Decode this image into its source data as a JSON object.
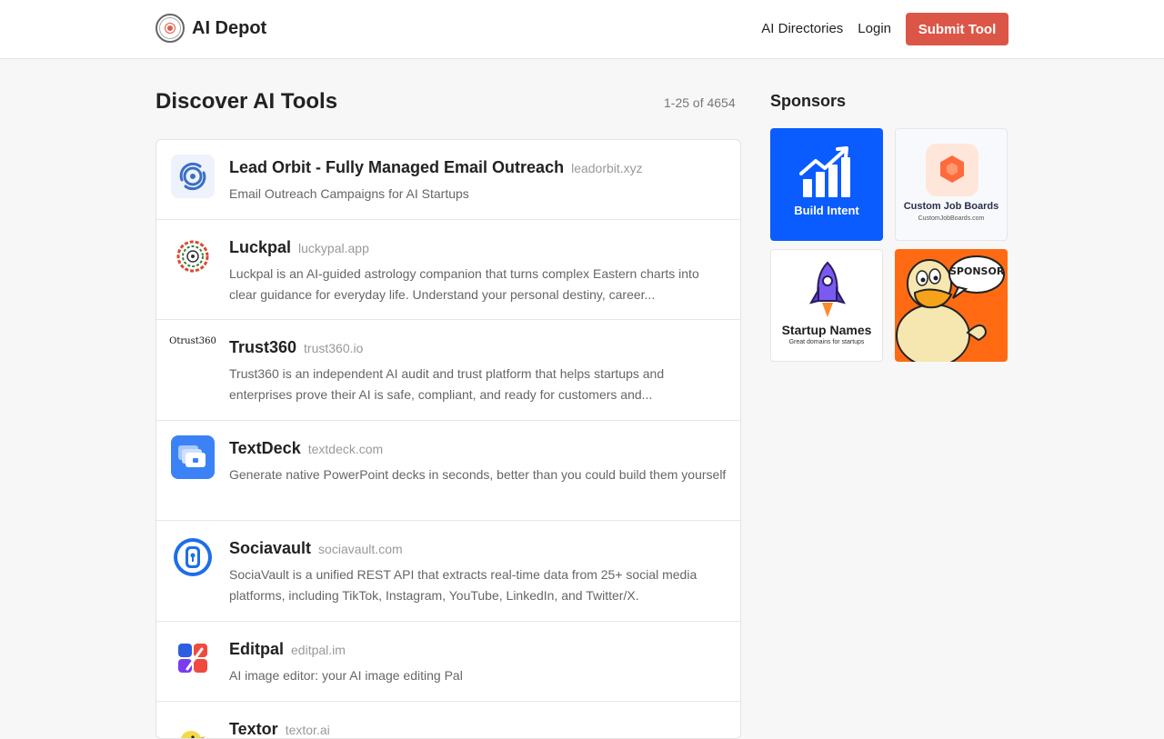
{
  "header": {
    "brand": "AI Depot",
    "nav": {
      "directories": "AI Directories",
      "login": "Login",
      "submit": "Submit Tool"
    }
  },
  "main": {
    "title": "Discover AI Tools",
    "count": "1-25 of 4654"
  },
  "tools": [
    {
      "name": "Lead Orbit - Fully Managed Email Outreach",
      "domain": "leadorbit.xyz",
      "description": "Email Outreach Campaigns for AI Startups"
    },
    {
      "name": "Luckpal",
      "domain": "luckypal.app",
      "description": "Luckpal is an AI-guided astrology companion that turns complex Eastern charts into clear guidance for everyday life. Understand your personal destiny, career..."
    },
    {
      "name": "Trust360",
      "domain": "trust360.io",
      "description": "Trust360 is an independent AI audit and trust platform that helps startups and enterprises prove their AI is safe, compliant, and ready for customers and...",
      "logo_text": "Otrust360"
    },
    {
      "name": "TextDeck",
      "domain": "textdeck.com",
      "description": "Generate native PowerPoint decks in seconds, better than you could build them yourself"
    },
    {
      "name": "Sociavault",
      "domain": "sociavault.com",
      "description": "SociaVault is a unified REST API that extracts real-time data from 25+ social media platforms, including TikTok, Instagram, YouTube, LinkedIn, and Twitter/X."
    },
    {
      "name": "Editpal",
      "domain": "editpal.im",
      "description": "AI image editor: your AI image editing Pal"
    },
    {
      "name": "Textor",
      "domain": "textor.ai",
      "description": ""
    }
  ],
  "sponsors": {
    "title": "Sponsors",
    "tiles": [
      {
        "label": "Build Intent",
        "bg": "#0a5cff"
      },
      {
        "label": "Custom Job Boards",
        "sub": "CustomJobBoards.com",
        "bg": "#f8f9fc"
      },
      {
        "label": "Startup Names",
        "sub": "Great domains for startups",
        "bg": "#ffffff"
      },
      {
        "label": "SPONSOR",
        "bg": "#ff6a13"
      }
    ]
  },
  "colors": {
    "accent": "#dc5647",
    "blue": "#3b82f6",
    "sponsor_blue": "#0a5cff",
    "sponsor_orange": "#ff6a13"
  }
}
